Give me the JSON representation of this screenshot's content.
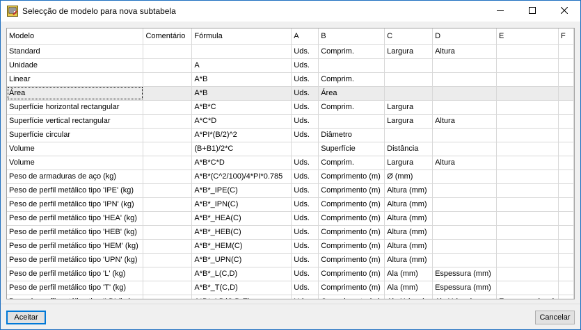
{
  "window": {
    "title": "Selecção de modelo para nova subtabela"
  },
  "table": {
    "columns": [
      "Modelo",
      "Comentário",
      "Fórmula",
      "A",
      "B",
      "C",
      "D",
      "E",
      "F"
    ],
    "rows": [
      [
        "Standard",
        "",
        "",
        "Uds.",
        "Comprim.",
        "Largura",
        "Altura",
        "",
        ""
      ],
      [
        "Unidade",
        "",
        "A",
        "Uds.",
        "",
        "",
        "",
        "",
        ""
      ],
      [
        "Linear",
        "",
        "A*B",
        "Uds.",
        "Comprim.",
        "",
        "",
        "",
        ""
      ],
      [
        "Área",
        "",
        "A*B",
        "Uds.",
        "Área",
        "",
        "",
        "",
        ""
      ],
      [
        "Superfície horizontal rectangular",
        "",
        "A*B*C",
        "Uds.",
        "Comprim.",
        "Largura",
        "",
        "",
        ""
      ],
      [
        "Superfície vertical rectangular",
        "",
        "A*C*D",
        "Uds.",
        "",
        "Largura",
        "Altura",
        "",
        ""
      ],
      [
        "Superfície circular",
        "",
        "A*PI*(B/2)^2",
        "Uds.",
        "Diâmetro",
        "",
        "",
        "",
        ""
      ],
      [
        "Volume",
        "",
        "(B+B1)/2*C",
        "",
        "Superfície",
        "Distância",
        "",
        "",
        ""
      ],
      [
        "Volume",
        "",
        "A*B*C*D",
        "Uds.",
        "Comprim.",
        "Largura",
        "Altura",
        "",
        ""
      ],
      [
        "Peso de armaduras de aço (kg)",
        "",
        "A*B*(C^2/100)/4*PI*0.785",
        "Uds.",
        "Comprimento (m)",
        "Ø (mm)",
        "",
        "",
        ""
      ],
      [
        "Peso de perfil metálico tipo 'IPE' (kg)",
        "",
        "A*B*_IPE(C)",
        "Uds.",
        "Comprimento (m)",
        "Altura (mm)",
        "",
        "",
        ""
      ],
      [
        "Peso de perfil metálico tipo 'IPN' (kg)",
        "",
        "A*B*_IPN(C)",
        "Uds.",
        "Comprimento (m)",
        "Altura (mm)",
        "",
        "",
        ""
      ],
      [
        "Peso de perfil metálico tipo 'HEA' (kg)",
        "",
        "A*B*_HEA(C)",
        "Uds.",
        "Comprimento (m)",
        "Altura (mm)",
        "",
        "",
        ""
      ],
      [
        "Peso de perfil metálico tipo 'HEB' (kg)",
        "",
        "A*B*_HEB(C)",
        "Uds.",
        "Comprimento (m)",
        "Altura (mm)",
        "",
        "",
        ""
      ],
      [
        "Peso de perfil metálico tipo 'HEM' (kg)",
        "",
        "A*B*_HEM(C)",
        "Uds.",
        "Comprimento (m)",
        "Altura (mm)",
        "",
        "",
        ""
      ],
      [
        "Peso de perfil metálico tipo 'UPN' (kg)",
        "",
        "A*B*_UPN(C)",
        "Uds.",
        "Comprimento (m)",
        "Altura (mm)",
        "",
        "",
        ""
      ],
      [
        "Peso de perfil metálico tipo 'L' (kg)",
        "",
        "A*B*_L(C,D)",
        "Uds.",
        "Comprimento (m)",
        "Ala (mm)",
        "Espessura (mm)",
        "",
        ""
      ],
      [
        "Peso de perfil metálico tipo 'T' (kg)",
        "",
        "A*B*_T(C,D)",
        "Uds.",
        "Comprimento (m)",
        "Ala (mm)",
        "Espessura (mm)",
        "",
        ""
      ],
      [
        "Peso de perfil metálico tipo 'LD' (kg)",
        "",
        "A*B*_LD(C,D,E)",
        "Uds.",
        "Comprimento (m)",
        "Ala X (mm)",
        "Ala Y (mm)",
        "Espessura (mm)",
        ""
      ]
    ],
    "selected_row": 3
  },
  "buttons": {
    "accept": "Aceitar",
    "cancel": "Cancelar"
  },
  "colors": {
    "border_accent": "#1e6fc0",
    "selection": "#ececec",
    "button_face": "#e1e1e1"
  },
  "icons": {
    "app": "app-icon",
    "minimize": "minimize-icon",
    "maximize": "maximize-icon",
    "close": "close-icon"
  }
}
